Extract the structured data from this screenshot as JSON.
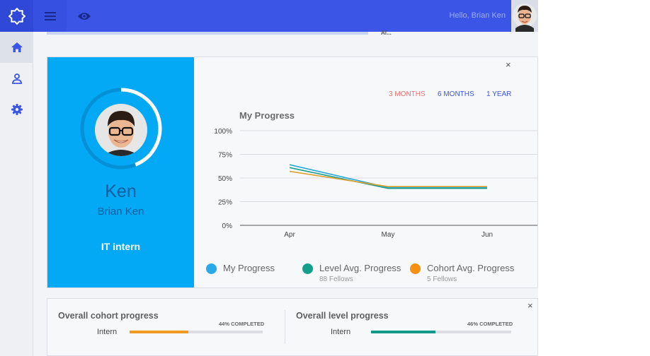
{
  "header": {
    "greeting": "Hello, Brian Ken",
    "icons": [
      "logo-icon",
      "menu-icon",
      "eye-icon"
    ]
  },
  "sidebar": {
    "items": [
      {
        "icon": "home-icon",
        "active": true
      },
      {
        "icon": "person-icon",
        "active": false
      },
      {
        "icon": "gear-icon",
        "active": false
      }
    ]
  },
  "background_strip": {
    "text": "Al..."
  },
  "profile": {
    "nickname": "Ken",
    "fullname": "Brian Ken",
    "role": "IT intern",
    "ring_progress": 0.44,
    "colors": {
      "panel": "#03a9f4",
      "ring": "#ffffff",
      "ring_track": "#0390d6"
    }
  },
  "progress_panel": {
    "ranges": [
      {
        "label": "3 MONTHS",
        "color": "#e57373"
      },
      {
        "label": "6 MONTHS",
        "color": "#3b55e6"
      },
      {
        "label": "1 YEAR",
        "color": "#3b55e6"
      }
    ],
    "close_label": "×"
  },
  "chart_data": {
    "type": "line",
    "title": "My Progress",
    "categories": [
      "Apr",
      "May",
      "Jun"
    ],
    "ylim": [
      0,
      100
    ],
    "yticks": [
      "100%",
      "75%",
      "50%",
      "25%",
      "0%"
    ],
    "grid": true,
    "series": [
      {
        "name": "My Progress",
        "color": "#29a9d6",
        "values": [
          64,
          40,
          40
        ]
      },
      {
        "name": "Level Avg. Progress",
        "color": "#1e9e8c",
        "values": [
          61,
          39,
          39
        ]
      },
      {
        "name": "Cohort Avg. Progress",
        "color": "#e0a030",
        "values": [
          57,
          41,
          41
        ]
      }
    ]
  },
  "legend": [
    {
      "label": "My Progress",
      "sub": "",
      "color": "#29a9e8"
    },
    {
      "label": "Level Avg. Progress",
      "sub": "88 Fellows",
      "color": "#12a08a"
    },
    {
      "label": "Cohort Avg. Progress",
      "sub": "5 Fellows",
      "color": "#f7900f"
    }
  ],
  "overall": {
    "close_label": "×",
    "cohort": {
      "title": "Overall cohort progress",
      "label": "Intern",
      "pct_text": "44% COMPLETED",
      "fraction": 0.44,
      "color": "#f09a22"
    },
    "level": {
      "title": "Overall level progress",
      "label": "Intern",
      "pct_text": "46% COMPLETED",
      "fraction": 0.46,
      "color": "#12998a"
    }
  }
}
